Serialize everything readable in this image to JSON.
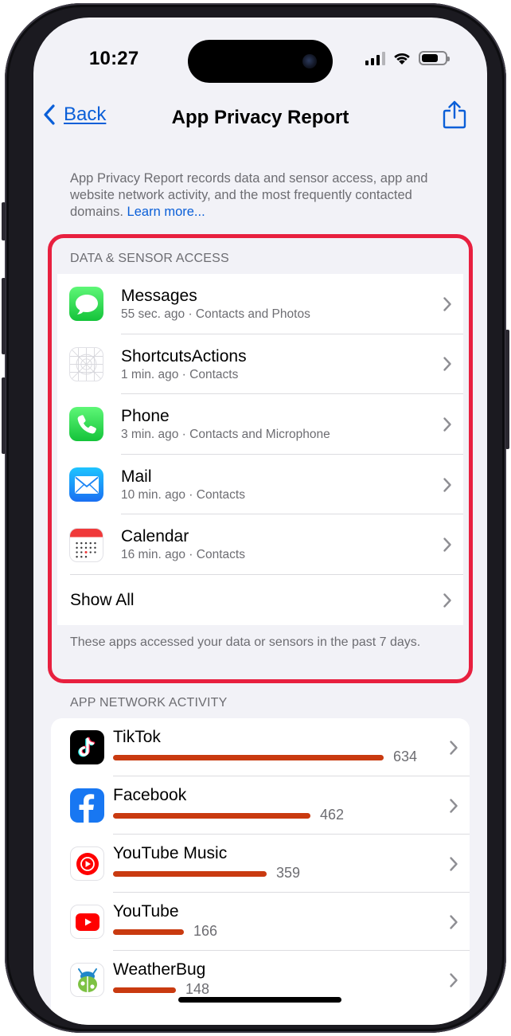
{
  "status": {
    "time": "10:27"
  },
  "nav": {
    "back_label": "Back",
    "title": "App Privacy Report"
  },
  "intro": {
    "text": "App Privacy Report records data and sensor access, app and website network activity, and the most frequently contacted domains.",
    "link": "Learn more..."
  },
  "data_sensor": {
    "header": "DATA & SENSOR ACCESS",
    "items": [
      {
        "name": "Messages",
        "detail": "55 sec. ago · Contacts and Photos",
        "icon": "messages-icon"
      },
      {
        "name": "ShortcutsActions",
        "detail": "1 min. ago · Contacts",
        "icon": "shortcuts-actions-icon"
      },
      {
        "name": "Phone",
        "detail": "3 min. ago · Contacts and Microphone",
        "icon": "phone-icon"
      },
      {
        "name": "Mail",
        "detail": "10 min. ago · Contacts",
        "icon": "mail-icon"
      },
      {
        "name": "Calendar",
        "detail": "16 min. ago · Contacts",
        "icon": "calendar-icon"
      }
    ],
    "show_all": "Show All",
    "footer": "These apps accessed your data or sensors in the past 7 days."
  },
  "network": {
    "header": "APP NETWORK ACTIVITY",
    "bar_color": "#c93a10",
    "max": 634,
    "items": [
      {
        "name": "TikTok",
        "count": "634",
        "value": 634,
        "icon": "tiktok-icon"
      },
      {
        "name": "Facebook",
        "count": "462",
        "value": 462,
        "icon": "facebook-icon"
      },
      {
        "name": "YouTube Music",
        "count": "359",
        "value": 359,
        "icon": "youtube-music-icon"
      },
      {
        "name": "YouTube",
        "count": "166",
        "value": 166,
        "icon": "youtube-icon"
      },
      {
        "name": "WeatherBug",
        "count": "148",
        "value": 148,
        "icon": "weatherbug-icon"
      }
    ]
  },
  "colors": {
    "accent": "#0a5fd8",
    "highlight": "#e8203f",
    "background": "#f2f2f7"
  }
}
